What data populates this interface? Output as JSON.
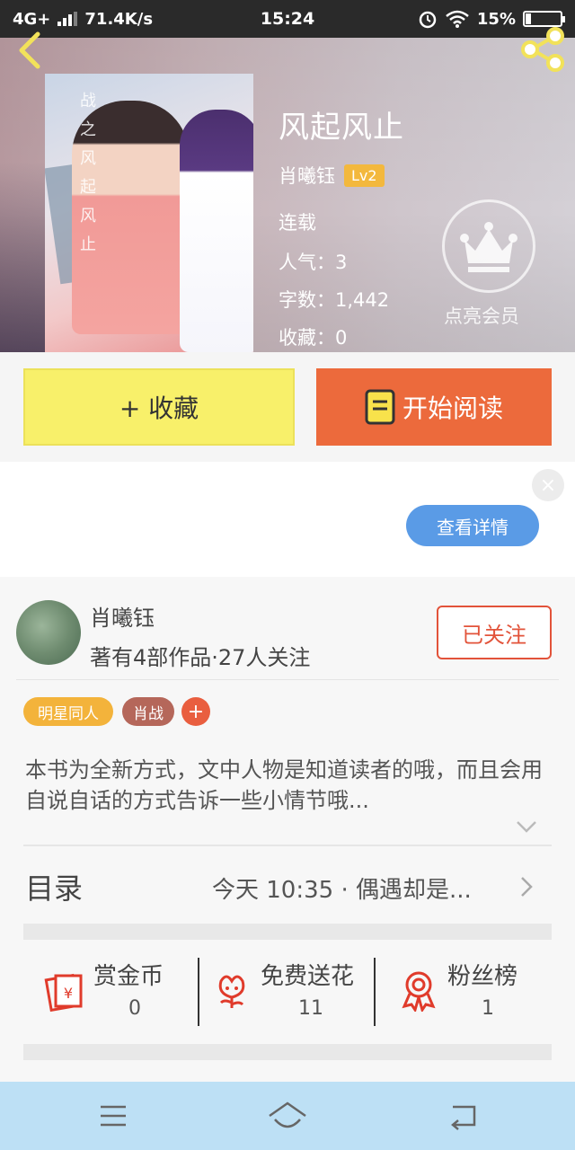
{
  "status_bar": {
    "network": "4G+",
    "speed": "71.4K/s",
    "time": "15:24",
    "battery": "15%",
    "battery_level": 0.15
  },
  "header": {
    "back_icon": "chevron-left-icon",
    "share_icon": "share-icon"
  },
  "book": {
    "cover_text": "战之风起风止",
    "title": "风起风止",
    "author": "肖曦钰",
    "level": "Lv2",
    "status": "连载",
    "popularity": "人气：3",
    "word_count": "字数：1,442",
    "favorites": "收藏：0"
  },
  "vip": {
    "icon": "crown-icon",
    "label": "点亮会员"
  },
  "actions": {
    "favorite_label": "+ 收藏",
    "read_label": "开始阅读",
    "fav_color": "#f8f06a",
    "read_color": "#ec6a3c"
  },
  "ad": {
    "close_icon": "close-icon",
    "details_label": "查看详情"
  },
  "author_card": {
    "name": "肖曦钰",
    "subtitle": "著有4部作品·27人关注",
    "follow_label": "已关注"
  },
  "tags": [
    {
      "label": "明星同人",
      "color": "#f3b33b"
    },
    {
      "label": "肖战",
      "color": "#b5675a"
    }
  ],
  "tag_add": "+",
  "intro": "本书为全新方式，文中人物是知道读者的哦，而且会用自说自话的方式告诉一些小情节哦...",
  "toc": {
    "label": "目录",
    "latest": "今天 10:35 · 偶遇却是..."
  },
  "stats": [
    {
      "label": "赏金币",
      "value": "0",
      "icon": "red-envelope-icon"
    },
    {
      "label": "免费送花",
      "value": "11",
      "icon": "flower-icon"
    },
    {
      "label": "粉丝榜",
      "value": "1",
      "icon": "medal-icon"
    }
  ],
  "nav": {
    "menu_icon": "menu-icon",
    "home_icon": "home-icon",
    "back_icon": "back-icon"
  }
}
